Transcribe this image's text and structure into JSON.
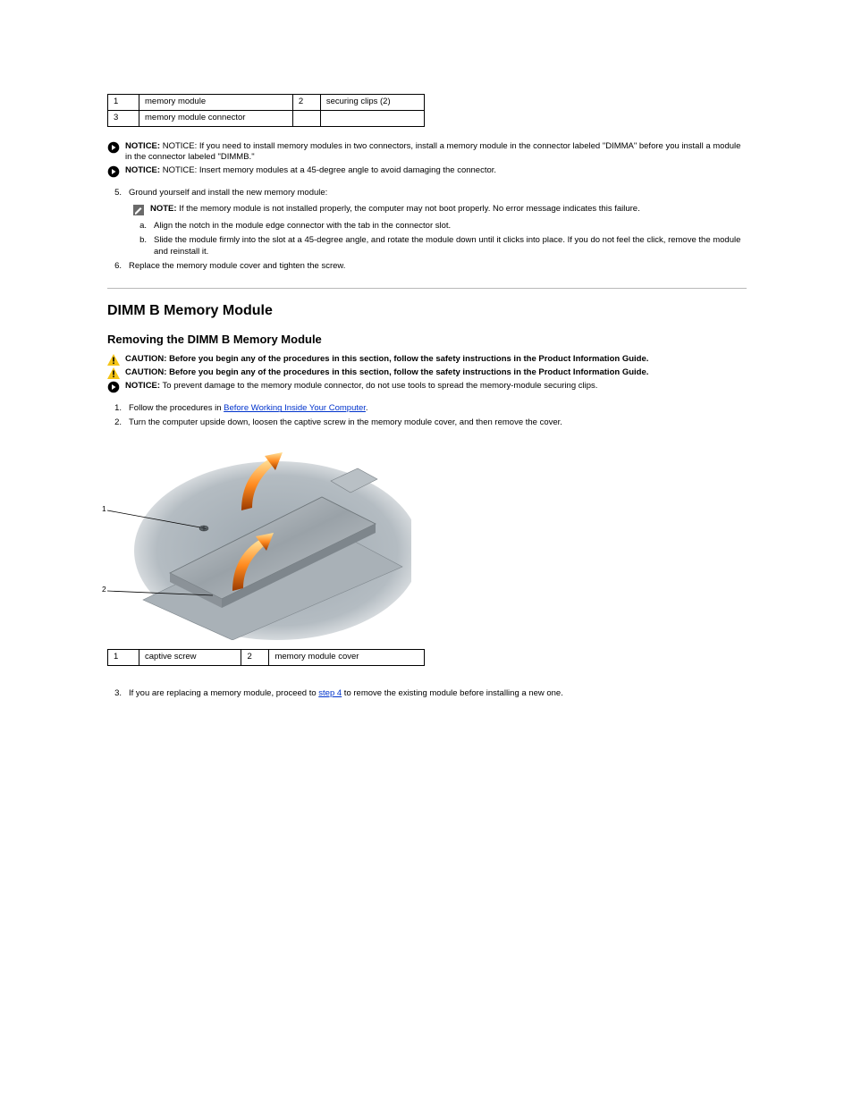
{
  "table1": {
    "rows": [
      {
        "n": "1",
        "label": "memory module",
        "n2": "2",
        "label2": "securing clips (2)"
      },
      {
        "n": "3",
        "label": "memory module connector",
        "n2": "",
        "label2": ""
      }
    ]
  },
  "notice1": "NOTICE: If you need to install memory modules in two connectors, install a memory module in the connector labeled \"DIMMA\" before you install a module in the connector labeled \"DIMMB.\"",
  "notice2": "NOTICE: Insert memory modules at a 45-degree angle to avoid damaging the connector.",
  "step5": {
    "n": "5.",
    "text": "Ground yourself and install the new memory module:"
  },
  "note1_label": "NOTE:",
  "note1_text": "If the memory module is not installed properly, the computer may not boot properly. No error message indicates this failure.",
  "sub_a": {
    "n": "a.",
    "text": "Align the notch in the module edge connector with the tab in the connector slot."
  },
  "sub_b": {
    "n": "b.",
    "text": "Slide the module firmly into the slot at a 45-degree angle, and rotate the module down until it clicks into place. If you do not feel the click, remove the module and reinstall it."
  },
  "step6": {
    "n": "6.",
    "text": "Replace the memory module cover and tighten the screw."
  },
  "hr_section_title": "DIMM B Memory Module",
  "sub_section_title": "Removing the DIMM B Memory Module",
  "caution1_label": "CAUTION:",
  "caution1_text": "Before you begin any of the procedures in this section, follow the safety instructions in the Product Information Guide.",
  "caution2_label": "CAUTION:",
  "caution2_text": "Before you begin any of the procedures in this section, follow the safety instructions in the Product Information Guide.",
  "notice3_label": "NOTICE:",
  "notice3_text": "To prevent damage to the memory module connector, do not use tools to spread the memory-module securing clips.",
  "step1b": {
    "n": "1.",
    "pre": "Follow the procedures in ",
    "link": "Before Working Inside Your Computer",
    "post": "."
  },
  "step2b": {
    "n": "2.",
    "text": "Turn the computer upside down, loosen the captive screw in the memory module cover, and then remove the cover."
  },
  "figure_callouts": {
    "c1": "1",
    "c2": "2"
  },
  "table2": {
    "rows": [
      {
        "n": "1",
        "label": "captive screw",
        "n2": "2",
        "label2": "memory module cover"
      }
    ]
  },
  "step3b": {
    "n": "3.",
    "pre": "If you are replacing a memory module, proceed to ",
    "link": "step 4",
    "post": " to remove the existing module before installing a new one."
  }
}
